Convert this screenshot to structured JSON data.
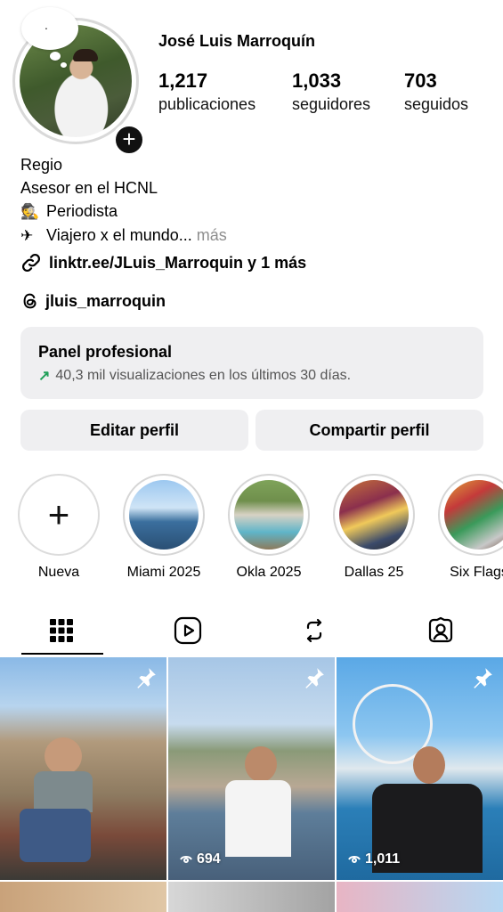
{
  "profile": {
    "name": "José Luis Marroquín",
    "note_bubble": ".",
    "stats": [
      {
        "value": "1,217",
        "label": "publicaciones"
      },
      {
        "value": "1,033",
        "label": "seguidores"
      },
      {
        "value": "703",
        "label": "seguidos"
      }
    ]
  },
  "bio": {
    "line1": "Regio",
    "line2": "Asesor en el HCNL",
    "line3": "Periodista",
    "line4": "Viajero x el mundo...",
    "more": "más",
    "link": "linktr.ee/JLuis_Marroquin y 1 más",
    "threads": "jluis_marroquin"
  },
  "panel": {
    "title": "Panel profesional",
    "subtitle": "40,3 mil visualizaciones en los últimos 30 días."
  },
  "buttons": {
    "edit": "Editar perfil",
    "share": "Compartir perfil"
  },
  "highlights": [
    {
      "label": "Nueva",
      "icon": "plus-icon"
    },
    {
      "label": "Miami 2025"
    },
    {
      "label": "Okla 2025"
    },
    {
      "label": "Dallas 25"
    },
    {
      "label": "Six Flags"
    }
  ],
  "tabs": [
    {
      "name": "grid",
      "icon": "grid-icon",
      "active": true
    },
    {
      "name": "reels",
      "icon": "reels-icon"
    },
    {
      "name": "reposts",
      "icon": "repost-icon"
    },
    {
      "name": "tagged",
      "icon": "tagged-icon"
    }
  ],
  "posts": [
    {
      "pinned": true,
      "views": ""
    },
    {
      "pinned": true,
      "views": "694"
    },
    {
      "pinned": true,
      "views": "1,011"
    }
  ],
  "colors": {
    "accent_green": "#22a05a",
    "button_bg": "#efeff1",
    "muted_text": "#8e8e8e"
  }
}
